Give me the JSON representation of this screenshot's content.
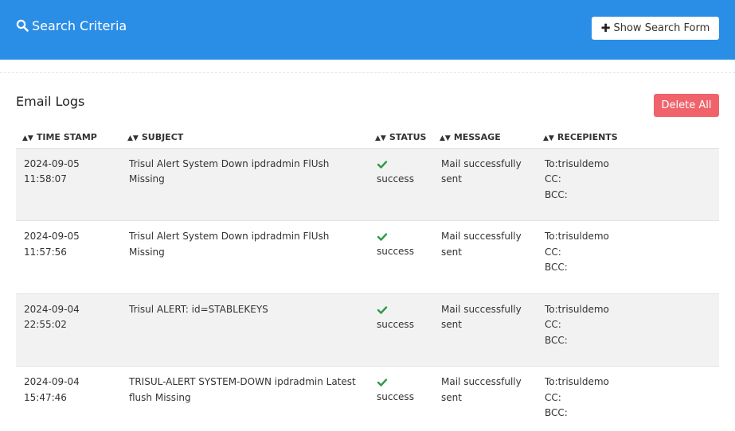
{
  "header": {
    "title": "Search Criteria",
    "show_form_label": "Show Search Form"
  },
  "section": {
    "title": "Email Logs",
    "delete_all_label": "Delete All"
  },
  "table": {
    "columns": [
      "TIME STAMP",
      "SUBJECT",
      "STATUS",
      "MESSAGE",
      "RECEPIENTS"
    ],
    "rows": [
      {
        "date": "2024-09-05",
        "time": "11:58:07",
        "subject": "Trisul Alert System Down ipdradmin FlUsh Missing",
        "status": "success",
        "message": "Mail successfully sent",
        "to": "To:trisuldemo",
        "cc": "CC:",
        "bcc": "BCC:"
      },
      {
        "date": "2024-09-05",
        "time": "11:57:56",
        "subject": "Trisul Alert System Down ipdradmin FlUsh Missing",
        "status": "success",
        "message": "Mail successfully sent",
        "to": "To:trisuldemo",
        "cc": "CC:",
        "bcc": "BCC:"
      },
      {
        "date": "2024-09-04",
        "time": "22:55:02",
        "subject": "Trisul ALERT: id=STABLEKEYS",
        "status": "success",
        "message": "Mail successfully sent",
        "to": "To:trisuldemo",
        "cc": "CC:",
        "bcc": "BCC:"
      },
      {
        "date": "2024-09-04",
        "time": "15:47:46",
        "subject": "TRISUL-ALERT SYSTEM-DOWN ipdradmin Latest flush Missing",
        "status": "success",
        "message": "Mail successfully sent",
        "to": "To:trisuldemo",
        "cc": "CC:",
        "bcc": "BCC:"
      }
    ]
  },
  "colors": {
    "header_bg": "#2b8ee6",
    "delete_bg": "#f0636b",
    "success": "#2e9a4a",
    "row_alt": "#f2f2f2"
  },
  "icons": {
    "header": "search-icon",
    "show_form": "plus-icon",
    "sort": "sort-icon",
    "status": "check-icon"
  }
}
